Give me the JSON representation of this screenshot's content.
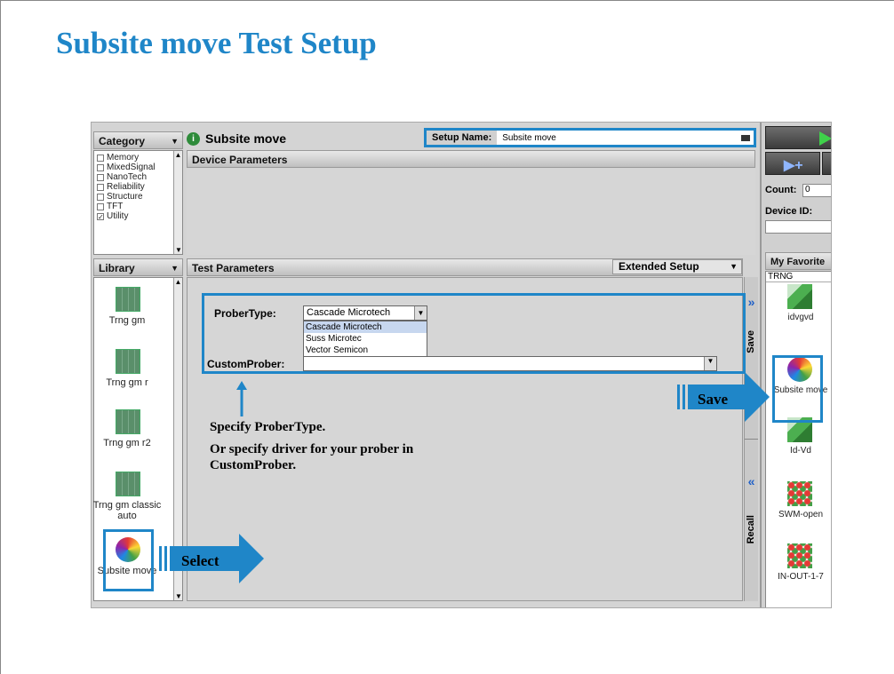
{
  "title": "Subsite move Test Setup",
  "category": {
    "header": "Category",
    "items": [
      {
        "label": "Memory",
        "checked": false
      },
      {
        "label": "MixedSignal",
        "checked": false
      },
      {
        "label": "NanoTech",
        "checked": false
      },
      {
        "label": "Reliability",
        "checked": false
      },
      {
        "label": "Structure",
        "checked": false
      },
      {
        "label": "TFT",
        "checked": false
      },
      {
        "label": "Utility",
        "checked": true
      }
    ]
  },
  "library": {
    "header": "Library",
    "items": [
      {
        "label": "Trng gm"
      },
      {
        "label": "Trng gm r"
      },
      {
        "label": "Trng gm r2"
      },
      {
        "label": "Trng gm classic auto"
      },
      {
        "label": "Subsite move"
      }
    ]
  },
  "setup": {
    "info_icon": "info-icon",
    "name_header": "Subsite move",
    "setup_name_label": "Setup Name:",
    "setup_name_value": "Subsite move"
  },
  "device_parameters": {
    "header": "Device Parameters"
  },
  "test_parameters": {
    "header": "Test Parameters",
    "extended": "Extended Setup",
    "prober_type_label": "ProberType:",
    "prober_type_value": "Cascade Microtech",
    "prober_options": [
      "Cascade Microtech",
      "Suss Microtec",
      "Vector Semicon"
    ],
    "custom_prober_label": "CustomProber:",
    "custom_prober_value": ""
  },
  "side_tabs": {
    "save": "Save",
    "recall": "Recall",
    "expand": "»",
    "collapse": "«"
  },
  "right_panel": {
    "count_label": "Count:",
    "count_value": "0",
    "device_id_label": "Device ID:",
    "device_id_value": "",
    "favorite_header": "My Favorite",
    "favorite_group": "TRNG",
    "favorites": [
      "idvgvd",
      "Subsite move",
      "Id-Vd",
      "SWM-open",
      "IN-OUT-1-7"
    ]
  },
  "callouts": {
    "specify_line1": "Specify ProberType.",
    "specify_line2": "Or specify driver for your prober in",
    "specify_line3": "CustomProber.",
    "select": "Select",
    "save": "Save"
  },
  "colors": {
    "accent": "#1f86c8"
  }
}
